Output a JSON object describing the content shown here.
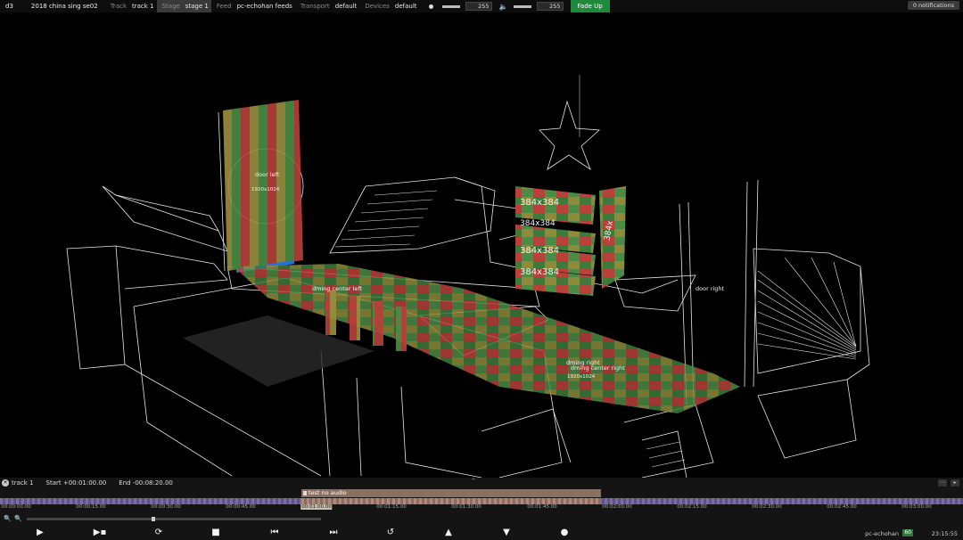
{
  "topbar": {
    "app": "d3",
    "project": "2018 china sing se02",
    "track_label": "Track",
    "track_value": "track 1",
    "stage_label": "Stage",
    "stage_value": "stage 1",
    "feed_label": "Feed",
    "feed_value": "pc-echohan feeds",
    "transport_label": "Transport",
    "transport_value": "default",
    "devices_label": "Devices",
    "devices_value": "default",
    "brightness_value": "255",
    "volume_value": "255",
    "fade_button": "Fade Up",
    "notifications": "0 notifications"
  },
  "viewport": {
    "labels": [
      {
        "id": "door-left",
        "text": "door left"
      },
      {
        "id": "door-right",
        "text": "door right"
      },
      {
        "id": "led-res-1",
        "text": "384x384"
      },
      {
        "id": "led-res-2",
        "text": "384x384"
      },
      {
        "id": "led-res-3",
        "text": "384x384"
      },
      {
        "id": "led-res-4",
        "text": "384x384"
      },
      {
        "id": "led-res-5",
        "text": "384x"
      },
      {
        "id": "projector-left",
        "text": "dming center left"
      },
      {
        "id": "projector-right",
        "text": "dming right"
      },
      {
        "id": "projector-center-right",
        "text": "dming center right"
      },
      {
        "id": "res-left",
        "text": "1920x1024"
      },
      {
        "id": "res-right",
        "text": "1920x1024"
      }
    ]
  },
  "timeline": {
    "track_name": "track 1",
    "start": "Start +00:01:00.00",
    "end": "End -00:08:20.00",
    "audio_clip": "test no audio",
    "ticks": [
      "00:00:00.00",
      "00:00:15.00",
      "00:00:30.00",
      "00:00:45.00",
      "00:01:00.00",
      "00:01:15.00",
      "00:01:30.00",
      "00:01:45.00",
      "00:02:00.00",
      "00:02:15.00",
      "00:02:30.00",
      "00:02:45.00",
      "00:03:00.00"
    ],
    "host": "pc-echohan",
    "fps": "60",
    "clock": "23:15:55"
  },
  "colors": {
    "accent_green": "#1e8a3c",
    "timeline_clip": "#8a7061",
    "track_strip": "#7b6ea0"
  }
}
